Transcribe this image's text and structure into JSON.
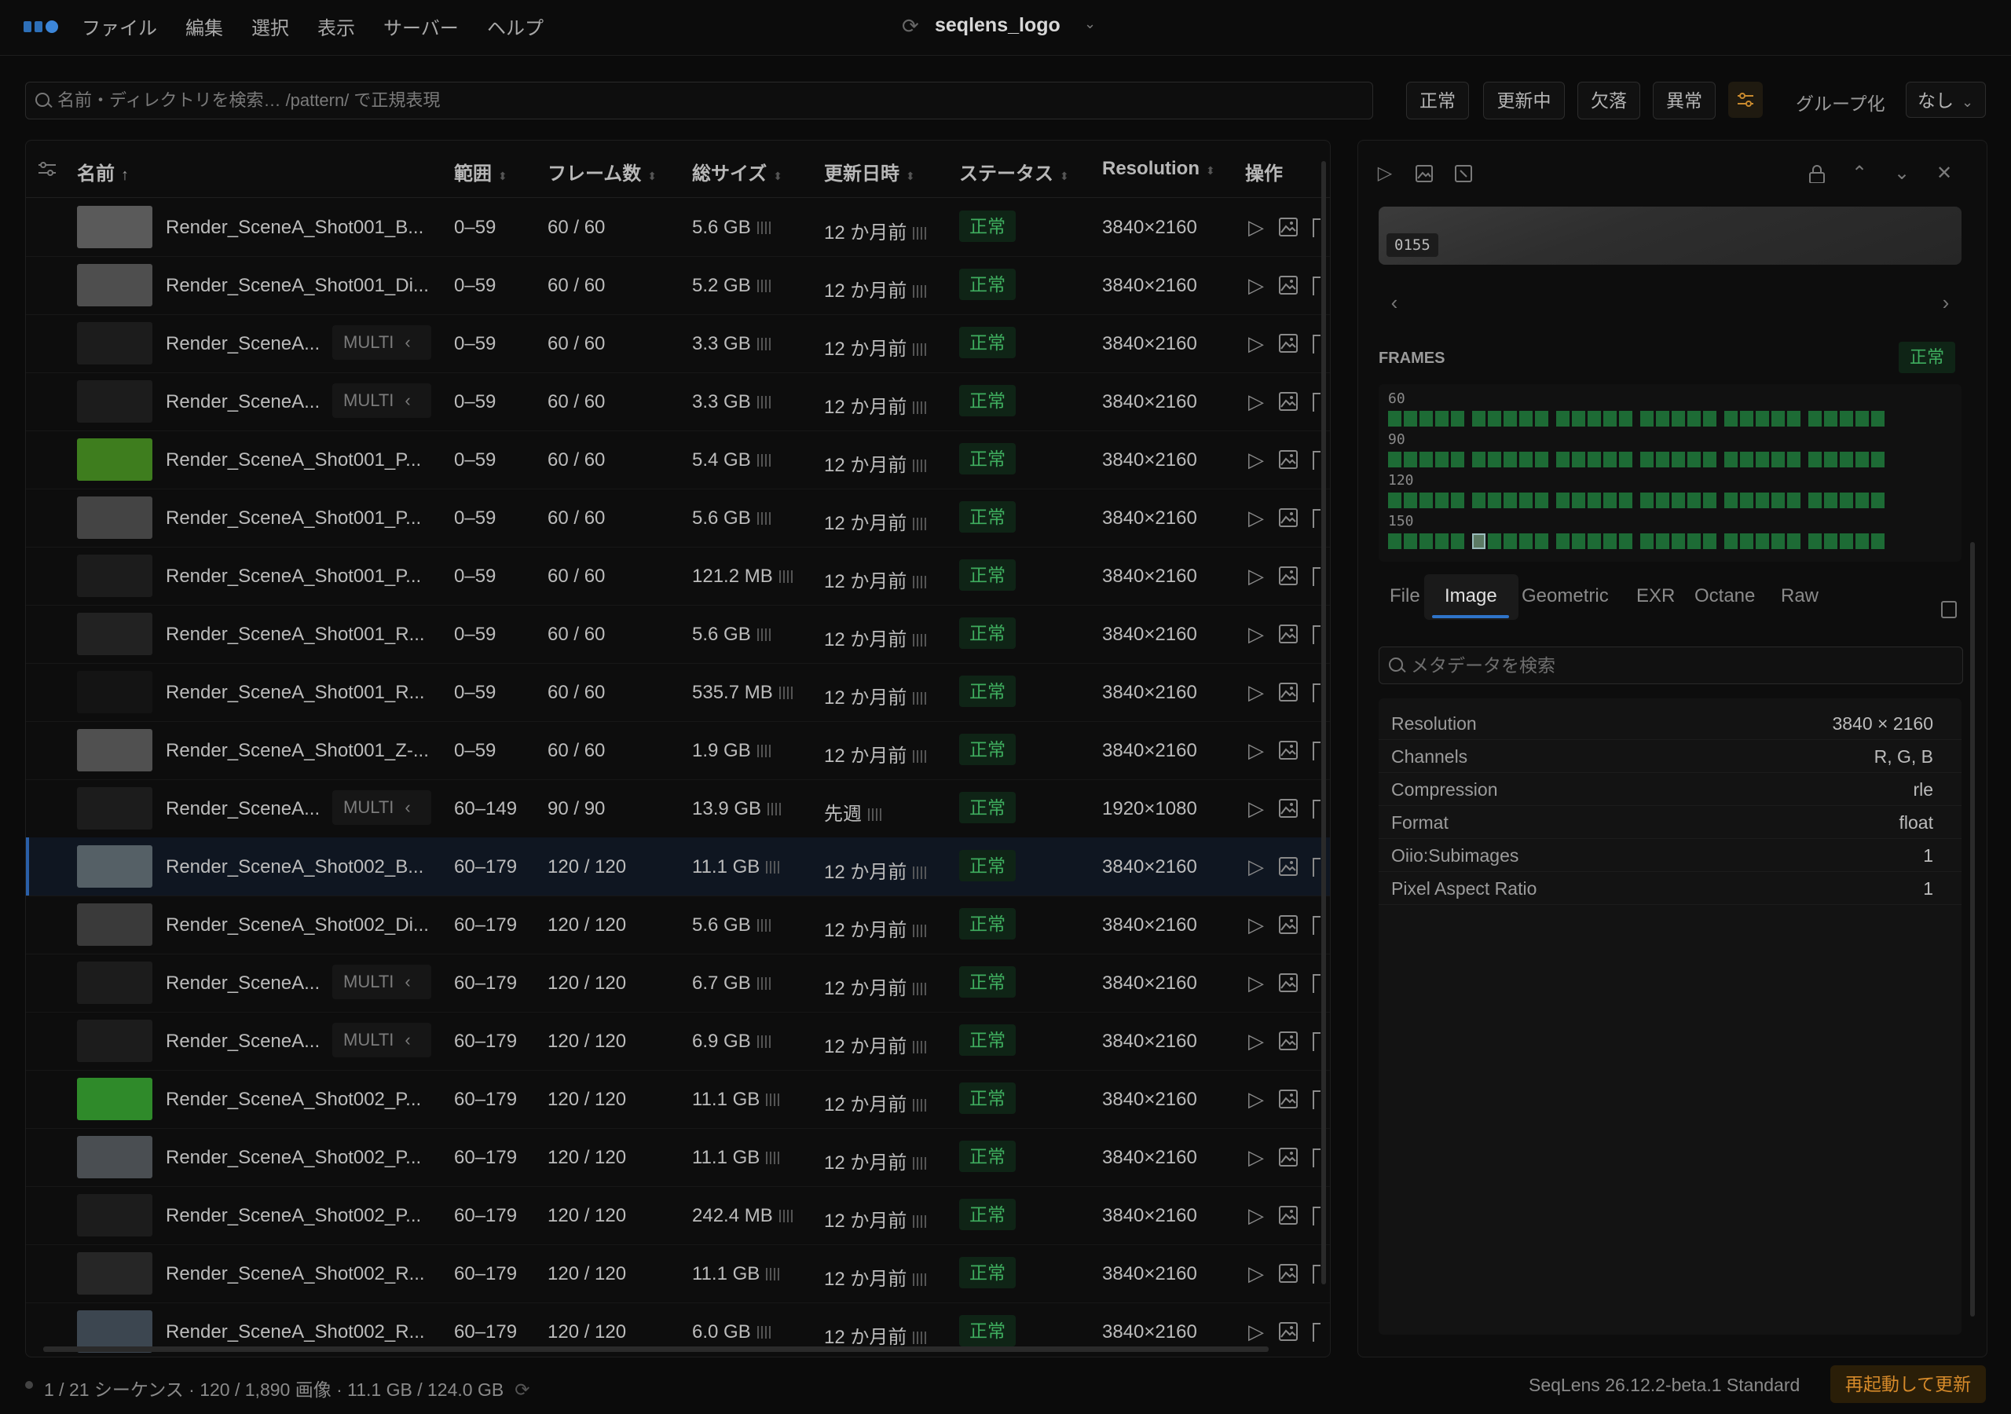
{
  "menu": {
    "items": [
      "ファイル",
      "編集",
      "選択",
      "表示",
      "サーバー",
      "ヘルプ"
    ],
    "project_title": "seqlens_logo"
  },
  "search": {
    "placeholder": "名前・ディレクトリを検索… /pattern/ で正規表現"
  },
  "filters": {
    "normal": "正常",
    "updating": "更新中",
    "missing": "欠落",
    "abnormal": "異常",
    "group_label": "グループ化",
    "group_value": "なし"
  },
  "table": {
    "columns": {
      "name": "名前",
      "range": "範囲",
      "frames": "フレーム数",
      "size": "総サイズ",
      "modified": "更新日時",
      "status": "ステータス",
      "resolution": "Resolution",
      "actions": "操作"
    },
    "rows": [
      {
        "name": "Render_SceneA_Shot001_B...",
        "multi": "",
        "range": "0–59",
        "frames": "60 / 60",
        "size": "5.6 GB",
        "modified": "12 か月前",
        "status": "正常",
        "resolution": "3840×2160",
        "thumb": "#5a5a5a"
      },
      {
        "name": "Render_SceneA_Shot001_Di...",
        "multi": "",
        "range": "0–59",
        "frames": "60 / 60",
        "size": "5.2 GB",
        "modified": "12 か月前",
        "status": "正常",
        "resolution": "3840×2160",
        "thumb": "#4e4e4e"
      },
      {
        "name": "Render_SceneA...",
        "multi": "MULTI",
        "range": "0–59",
        "frames": "60 / 60",
        "size": "3.3 GB",
        "modified": "12 か月前",
        "status": "正常",
        "resolution": "3840×2160",
        "thumb": "#1c1c1c"
      },
      {
        "name": "Render_SceneA...",
        "multi": "MULTI",
        "range": "0–59",
        "frames": "60 / 60",
        "size": "3.3 GB",
        "modified": "12 か月前",
        "status": "正常",
        "resolution": "3840×2160",
        "thumb": "#1c1c1c"
      },
      {
        "name": "Render_SceneA_Shot001_P...",
        "multi": "",
        "range": "0–59",
        "frames": "60 / 60",
        "size": "5.4 GB",
        "modified": "12 か月前",
        "status": "正常",
        "resolution": "3840×2160",
        "thumb": "#3e7d1e"
      },
      {
        "name": "Render_SceneA_Shot001_P...",
        "multi": "",
        "range": "0–59",
        "frames": "60 / 60",
        "size": "5.6 GB",
        "modified": "12 か月前",
        "status": "正常",
        "resolution": "3840×2160",
        "thumb": "#444444"
      },
      {
        "name": "Render_SceneA_Shot001_P...",
        "multi": "",
        "range": "0–59",
        "frames": "60 / 60",
        "size": "121.2 MB",
        "modified": "12 か月前",
        "status": "正常",
        "resolution": "3840×2160",
        "thumb": "#1c1c1c"
      },
      {
        "name": "Render_SceneA_Shot001_R...",
        "multi": "",
        "range": "0–59",
        "frames": "60 / 60",
        "size": "5.6 GB",
        "modified": "12 か月前",
        "status": "正常",
        "resolution": "3840×2160",
        "thumb": "#222222"
      },
      {
        "name": "Render_SceneA_Shot001_R...",
        "multi": "",
        "range": "0–59",
        "frames": "60 / 60",
        "size": "535.7 MB",
        "modified": "12 か月前",
        "status": "正常",
        "resolution": "3840×2160",
        "thumb": "#141414"
      },
      {
        "name": "Render_SceneA_Shot001_Z-...",
        "multi": "",
        "range": "0–59",
        "frames": "60 / 60",
        "size": "1.9 GB",
        "modified": "12 か月前",
        "status": "正常",
        "resolution": "3840×2160",
        "thumb": "#505050"
      },
      {
        "name": "Render_SceneA...",
        "multi": "MULTI",
        "range": "60–149",
        "frames": "90 / 90",
        "size": "13.9 GB",
        "modified": "先週",
        "status": "正常",
        "resolution": "1920×1080",
        "thumb": "#1c1c1c"
      },
      {
        "name": "Render_SceneA_Shot002_B...",
        "multi": "",
        "range": "60–179",
        "frames": "120 / 120",
        "size": "11.1 GB",
        "modified": "12 か月前",
        "status": "正常",
        "resolution": "3840×2160",
        "thumb": "#556066",
        "selected": true
      },
      {
        "name": "Render_SceneA_Shot002_Di...",
        "multi": "",
        "range": "60–179",
        "frames": "120 / 120",
        "size": "5.6 GB",
        "modified": "12 か月前",
        "status": "正常",
        "resolution": "3840×2160",
        "thumb": "#3a3a3a"
      },
      {
        "name": "Render_SceneA...",
        "multi": "MULTI",
        "range": "60–179",
        "frames": "120 / 120",
        "size": "6.7 GB",
        "modified": "12 か月前",
        "status": "正常",
        "resolution": "3840×2160",
        "thumb": "#1c1c1c"
      },
      {
        "name": "Render_SceneA...",
        "multi": "MULTI",
        "range": "60–179",
        "frames": "120 / 120",
        "size": "6.9 GB",
        "modified": "12 か月前",
        "status": "正常",
        "resolution": "3840×2160",
        "thumb": "#1c1c1c"
      },
      {
        "name": "Render_SceneA_Shot002_P...",
        "multi": "",
        "range": "60–179",
        "frames": "120 / 120",
        "size": "11.1 GB",
        "modified": "12 か月前",
        "status": "正常",
        "resolution": "3840×2160",
        "thumb": "#2f8a2a"
      },
      {
        "name": "Render_SceneA_Shot002_P...",
        "multi": "",
        "range": "60–179",
        "frames": "120 / 120",
        "size": "11.1 GB",
        "modified": "12 か月前",
        "status": "正常",
        "resolution": "3840×2160",
        "thumb": "#4a4e52"
      },
      {
        "name": "Render_SceneA_Shot002_P...",
        "multi": "",
        "range": "60–179",
        "frames": "120 / 120",
        "size": "242.4 MB",
        "modified": "12 か月前",
        "status": "正常",
        "resolution": "3840×2160",
        "thumb": "#1c1c1c"
      },
      {
        "name": "Render_SceneA_Shot002_R...",
        "multi": "",
        "range": "60–179",
        "frames": "120 / 120",
        "size": "11.1 GB",
        "modified": "12 か月前",
        "status": "正常",
        "resolution": "3840×2160",
        "thumb": "#262626"
      },
      {
        "name": "Render_SceneA_Shot002_R...",
        "multi": "",
        "range": "60–179",
        "frames": "120 / 120",
        "size": "6.0 GB",
        "modified": "12 か月前",
        "status": "正常",
        "resolution": "3840×2160",
        "thumb": "#3c4650"
      }
    ]
  },
  "detail": {
    "current_frame": "0155",
    "frames_label": "FRAMES",
    "frames_status": "正常",
    "frame_rows": [
      "60",
      "90",
      "120",
      "150"
    ],
    "tabs": [
      "File",
      "Image",
      "Geometric",
      "EXR",
      "Octane",
      "Raw"
    ],
    "active_tab": "Image",
    "meta_search_placeholder": "メタデータを検索",
    "metadata": [
      {
        "key": "Resolution",
        "value": "3840 × 2160"
      },
      {
        "key": "Channels",
        "value": "R, G, B"
      },
      {
        "key": "Compression",
        "value": "rle"
      },
      {
        "key": "Format",
        "value": "float"
      },
      {
        "key": "Oiio:Subimages",
        "value": "1"
      },
      {
        "key": "Pixel Aspect Ratio",
        "value": "1"
      }
    ]
  },
  "statusbar": {
    "summary": "1 / 21 シーケンス · 120 / 1,890 画像 · 11.1 GB / 124.0 GB",
    "version": "SeqLens 26.12.2-beta.1 Standard",
    "restart_label": "再起動して更新"
  },
  "colors": {
    "accent": "#2f74c9",
    "status_ok": "#3fae5f",
    "warning": "#d68a2a"
  }
}
